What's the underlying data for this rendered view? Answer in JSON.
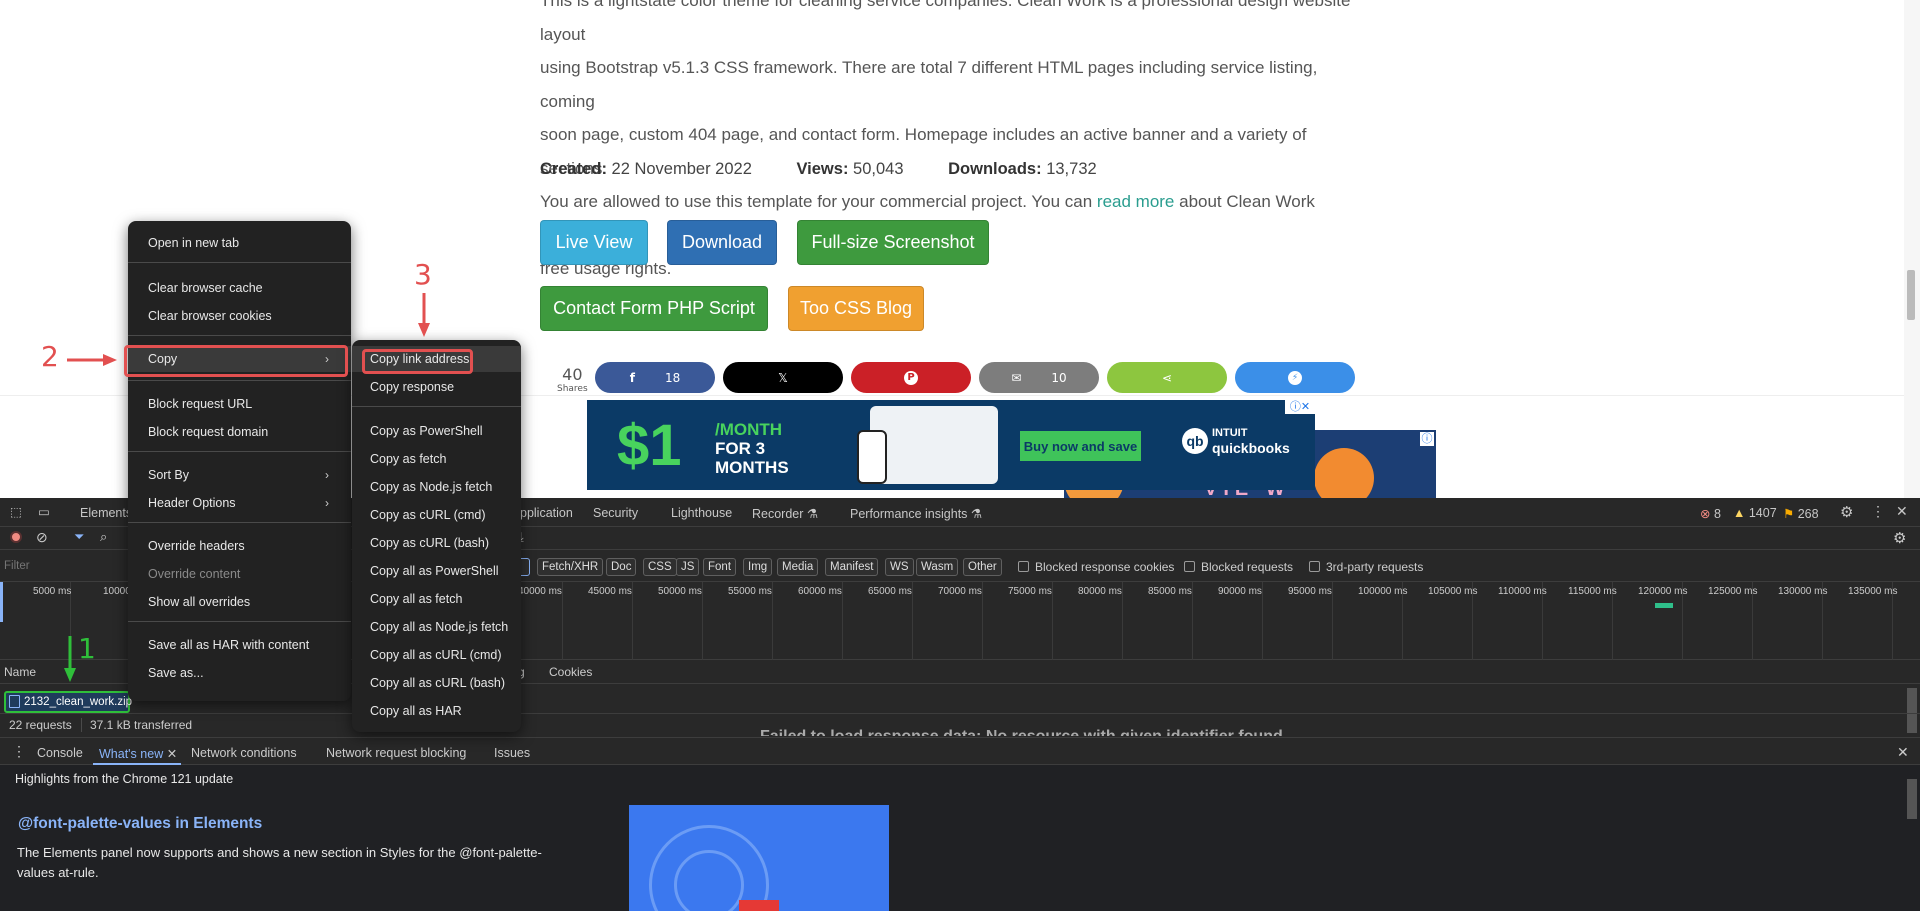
{
  "page": {
    "para_lines": [
      "This is a lightstate color theme for cleaning service companies. Clean Work is a professional design website layout",
      "using Bootstrap v5.1.3 CSS framework. There are total 7 different HTML pages including service listing, coming",
      "soon page, custom 404 page, and contact form. Homepage includes an active banner and a variety of sections."
    ],
    "para_line4_pre": "You are allowed to use this template for your commercial project. You can ",
    "para_link": "read more",
    "para_line4_post": " about Clean Work template",
    "para_line5": "free usage rights.",
    "created_label": "Created:",
    "created_value": "22 November 2022",
    "views_label": "Views:",
    "views_value": "50,043",
    "downloads_label": "Downloads:",
    "downloads_value": "13,732",
    "buttons": {
      "live_view": "Live View",
      "download": "Download",
      "screenshot": "Full-size Screenshot",
      "contact": "Contact Form PHP Script",
      "blog": "Too CSS Blog"
    },
    "button_colors": {
      "live_view": "#3bafda",
      "download": "#2f6fb3",
      "screenshot": "#3e9a3e",
      "contact": "#3e9a3e",
      "blog": "#f0a030"
    },
    "share_count": "40",
    "share_label": "Shares",
    "share": {
      "facebook_count": "18",
      "email_count": "10"
    },
    "ad": {
      "price": "$1",
      "per1": "/MONTH",
      "per2": "FOR 3",
      "per3": "MONTHS",
      "cta": "Buy now and save",
      "logo1": "INTUIT",
      "logo2": "quickbooks"
    },
    "ad2_partial": "VIE W"
  },
  "devtools": {
    "tabs": {
      "elements": "Elements",
      "application": "pplication",
      "security": "Security",
      "lighthouse": "Lighthouse",
      "recorder": "Recorder",
      "perf": "Performance insights"
    },
    "errors": "8",
    "warnings": "1407",
    "issues": "268",
    "filter_placeholder": "Filter",
    "types": [
      "Fetch/XHR",
      "Doc",
      "CSS",
      "JS",
      "Font",
      "Img",
      "Media",
      "Manifest",
      "WS",
      "Wasm",
      "Other"
    ],
    "checks": [
      "Blocked response cookies",
      "Blocked requests",
      "3rd-party requests"
    ],
    "timeline_labels": [
      "5000 ms",
      "10000",
      "40000 ms",
      "45000 ms",
      "50000 ms",
      "55000 ms",
      "60000 ms",
      "65000 ms",
      "70000 ms",
      "75000 ms",
      "80000 ms",
      "85000 ms",
      "90000 ms",
      "95000 ms",
      "100000 ms",
      "105000 ms",
      "110000 ms",
      "115000 ms",
      "120000 ms",
      "125000 ms",
      "130000 ms",
      "135000 ms"
    ],
    "name_header": "Name",
    "detail_tabs": [
      "g",
      "Cookies"
    ],
    "request_name": "2132_clean_work.zip",
    "requests": "22 requests",
    "transferred": "37.1 kB transferred",
    "partial_text": "Failed to load response data: No resource with given identifier found",
    "drawer_tabs": {
      "console": "Console",
      "whatsnew": "What's new",
      "netcond": "Network conditions",
      "netblock": "Network request blocking",
      "issues": "Issues"
    },
    "highlights": "Highlights from the Chrome 121 update",
    "feature_title": "@font-palette-values in Elements",
    "feature_desc1": "The Elements panel now supports and shows a new section in Styles for the @font-palette-",
    "feature_desc2": "values at-rule."
  },
  "context_menu": {
    "items": [
      "Open in new tab",
      "Clear browser cache",
      "Clear browser cookies",
      "Copy",
      "Block request URL",
      "Block request domain",
      "Sort By",
      "Header Options",
      "Override headers",
      "Override content",
      "Show all overrides",
      "Save all as HAR with content",
      "Save as..."
    ]
  },
  "copy_submenu": {
    "items": [
      "Copy link address",
      "Copy response",
      "Copy as PowerShell",
      "Copy as fetch",
      "Copy as Node.js fetch",
      "Copy as cURL (cmd)",
      "Copy as cURL (bash)",
      "Copy all as PowerShell",
      "Copy all as fetch",
      "Copy all as Node.js fetch",
      "Copy all as cURL (cmd)",
      "Copy all as cURL (bash)",
      "Copy all as HAR"
    ]
  },
  "annotations": {
    "one": "1",
    "two": "2",
    "three": "3"
  },
  "colors": {
    "annotation_red": "#e25050",
    "annotation_green": "#2fbf3a",
    "link": "#2a9d8f"
  }
}
